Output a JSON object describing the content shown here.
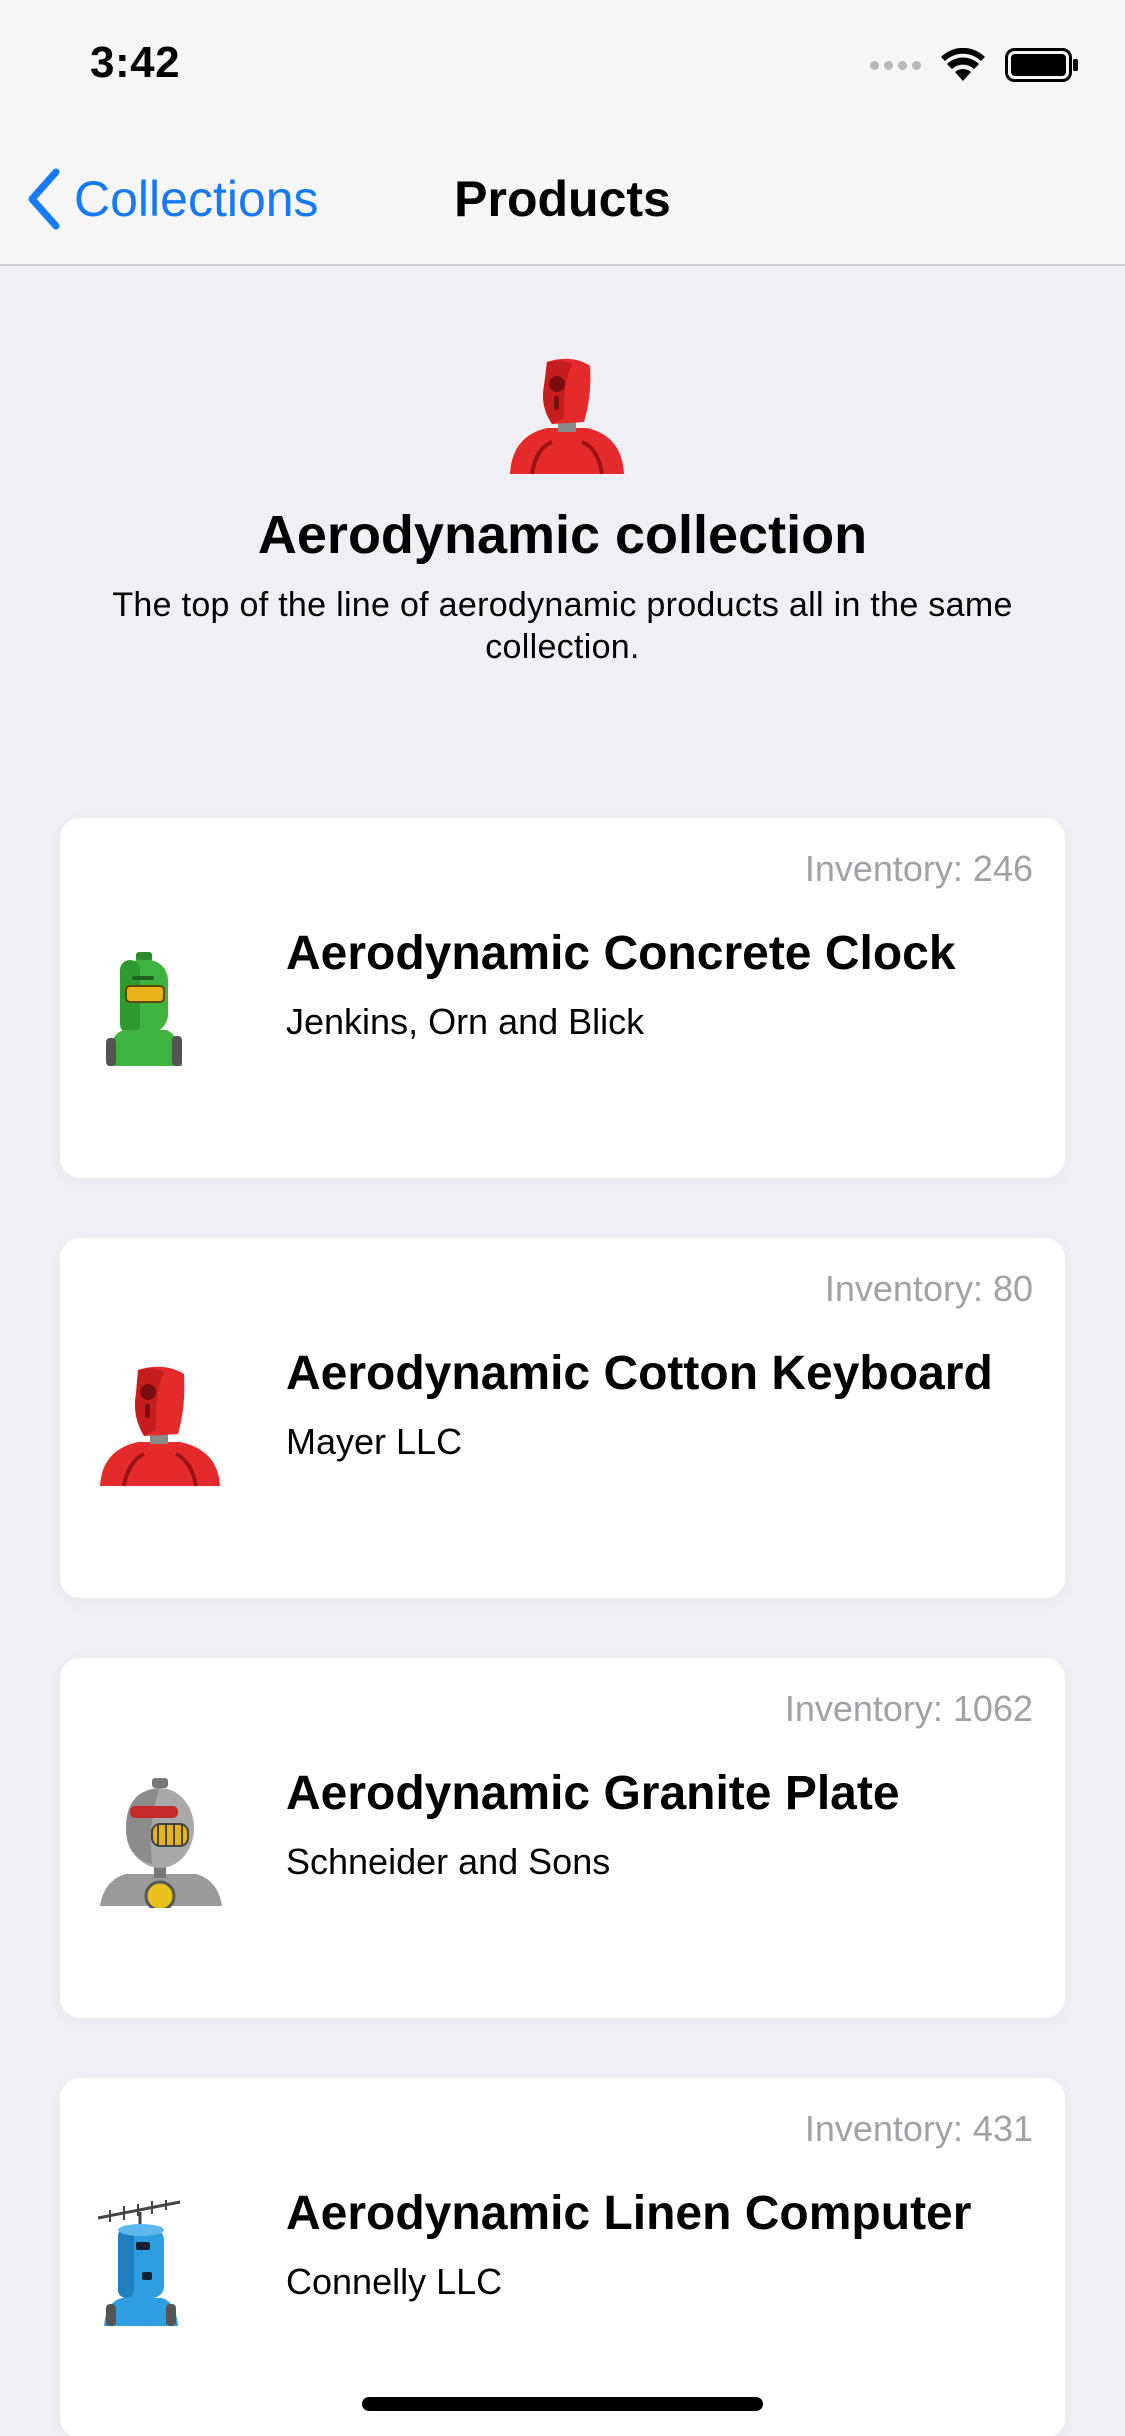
{
  "status_bar": {
    "time": "3:42"
  },
  "nav": {
    "back_label": "Collections",
    "title": "Products"
  },
  "collection": {
    "title": "Aerodynamic collection",
    "description": "The top of the line of aerodynamic products all in the same collection."
  },
  "products": [
    {
      "inventory": "Inventory: 246",
      "title": "Aerodynamic Concrete Clock",
      "vendor": "Jenkins, Orn and Blick",
      "image": "green-robot"
    },
    {
      "inventory": "Inventory: 80",
      "title": "Aerodynamic Cotton Keyboard",
      "vendor": "Mayer LLC",
      "image": "red-robot"
    },
    {
      "inventory": "Inventory: 1062",
      "title": "Aerodynamic Granite Plate",
      "vendor": "Schneider and Sons",
      "image": "grey-robot"
    },
    {
      "inventory": "Inventory: 431",
      "title": "Aerodynamic Linen Computer",
      "vendor": "Connelly LLC",
      "image": "blue-robot"
    }
  ],
  "colors": {
    "accent": "#1779f5",
    "background": "#efeff4",
    "card": "#ffffff",
    "secondary_text": "#a2a2a6"
  }
}
